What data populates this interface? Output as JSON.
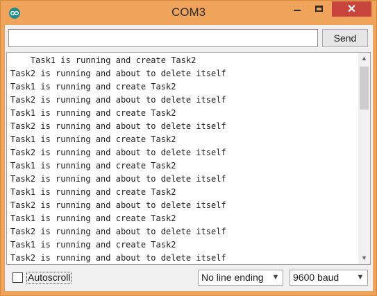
{
  "window": {
    "title": "COM3",
    "accent_color": "#f0a35a",
    "close_color": "#c7453c",
    "app_icon": "arduino-icon",
    "minimize_icon": "minimize-icon",
    "maximize_icon": "maximize-icon",
    "close_icon": "close-icon"
  },
  "input": {
    "value": "",
    "placeholder": ""
  },
  "send_label": "Send",
  "output_lines": [
    "    Task1 is running and create Task2",
    "Task2 is running and about to delete itself",
    "Task1 is running and create Task2",
    "Task2 is running and about to delete itself",
    "Task1 is running and create Task2",
    "Task2 is running and about to delete itself",
    "Task1 is running and create Task2",
    "Task2 is running and about to delete itself",
    "Task1 is running and create Task2",
    "Task2 is running and about to delete itself",
    "Task1 is running and create Task2",
    "Task2 is running and about to delete itself",
    "Task1 is running and create Task2",
    "Task2 is running and about to delete itself",
    "Task1 is running and create Task2",
    "Task2 is running and about to delete itself"
  ],
  "autoscroll": {
    "label": "Autoscroll",
    "checked": false
  },
  "line_ending": {
    "selected": "No line ending"
  },
  "baud_rate": {
    "selected": "9600 baud"
  }
}
